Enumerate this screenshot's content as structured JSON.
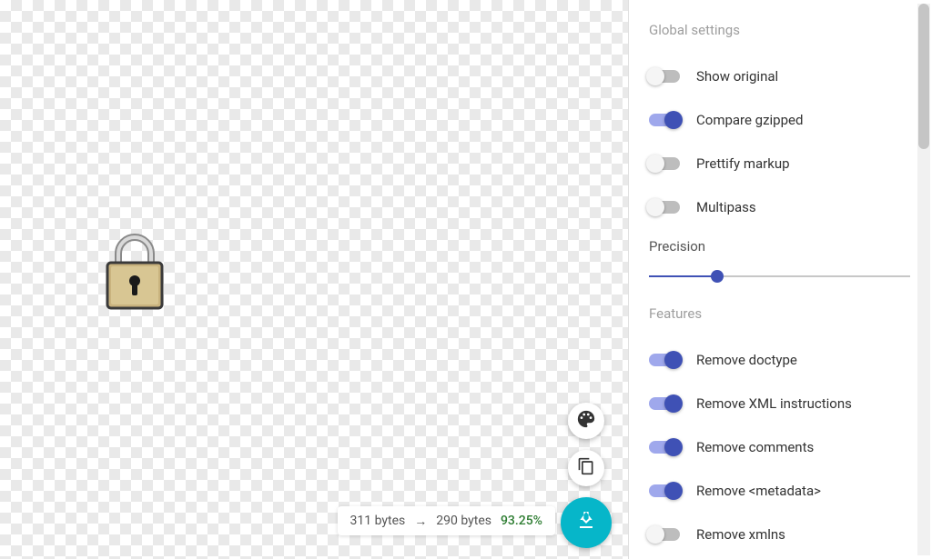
{
  "status": {
    "before_label": "311 bytes",
    "arrow": "→",
    "after_label": "290 bytes",
    "percent": "93.25%"
  },
  "panel": {
    "sections": {
      "global": {
        "title": "Global settings",
        "items": [
          {
            "label": "Show original",
            "on": false
          },
          {
            "label": "Compare gzipped",
            "on": true
          },
          {
            "label": "Prettify markup",
            "on": false
          },
          {
            "label": "Multipass",
            "on": false
          }
        ],
        "slider": {
          "label": "Precision",
          "value": 26
        }
      },
      "features": {
        "title": "Features",
        "items": [
          {
            "label": "Remove doctype",
            "on": true
          },
          {
            "label": "Remove XML instructions",
            "on": true
          },
          {
            "label": "Remove comments",
            "on": true
          },
          {
            "label": "Remove <metadata>",
            "on": true
          },
          {
            "label": "Remove xmlns",
            "on": false
          }
        ]
      }
    }
  }
}
